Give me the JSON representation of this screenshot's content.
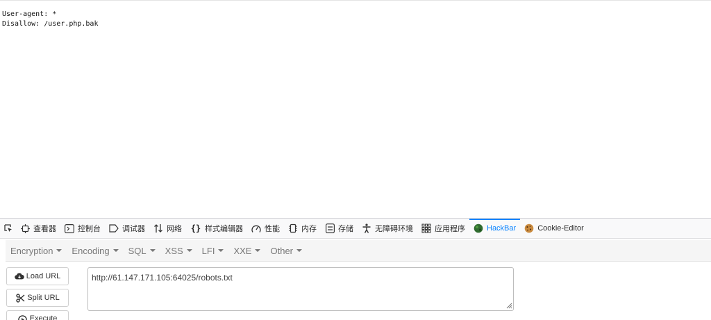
{
  "page": {
    "robots_text": "User-agent: *\nDisallow: /user.php.bak"
  },
  "devtools": {
    "tabs": [
      {
        "label": "查看器",
        "icon": "inspector-icon"
      },
      {
        "label": "控制台",
        "icon": "console-icon"
      },
      {
        "label": "调试器",
        "icon": "debugger-icon"
      },
      {
        "label": "网络",
        "icon": "network-icon"
      },
      {
        "label": "样式编辑器",
        "icon": "style-editor-icon"
      },
      {
        "label": "性能",
        "icon": "performance-icon"
      },
      {
        "label": "内存",
        "icon": "memory-icon"
      },
      {
        "label": "存储",
        "icon": "storage-icon"
      },
      {
        "label": "无障碍环境",
        "icon": "accessibility-icon"
      },
      {
        "label": "应用程序",
        "icon": "application-icon"
      },
      {
        "label": "HackBar",
        "icon": "hackbar-icon"
      },
      {
        "label": "Cookie-Editor",
        "icon": "cookie-icon"
      }
    ],
    "active_tab": "HackBar",
    "accent_color": "#0a84ff"
  },
  "hackbar": {
    "menu": [
      "Encryption",
      "Encoding",
      "SQL",
      "XSS",
      "LFI",
      "XXE",
      "Other"
    ],
    "buttons": {
      "load_url": "Load URL",
      "split_url": "Split URL",
      "execute": "Execute"
    },
    "url_value": "http://61.147.171.105:64025/robots.txt"
  }
}
